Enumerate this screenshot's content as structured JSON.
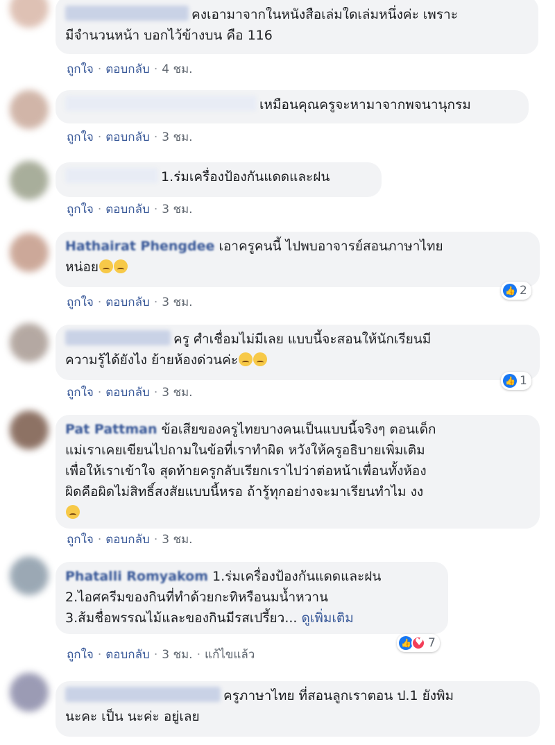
{
  "comments": [
    {
      "name": "",
      "text": "คงเอามาจากในหนังสือเล่มใดเล่มหนึ่งค่ะ เพราะมีจำนวนหน้า บอกไว้ข้างบน คือ 116",
      "line1": "คงเอามาจากในหนังสือเล่มใดเล่มหนึ่งค่ะ เพราะ",
      "line2": "มีจำนวนหน้า บอกไว้ข้างบน คือ 116",
      "like": "ถูกใจ",
      "reply": "ตอบกลับ",
      "time": "4 ชม."
    },
    {
      "name": "",
      "text": "เหมือนคุณครูจะหามาจากพจนานุกรม",
      "like": "ถูกใจ",
      "reply": "ตอบกลับ",
      "time": "3 ชม."
    },
    {
      "name": "",
      "text": "1.ร่มเครื่องป้องกันแดดและฝน",
      "like": "ถูกใจ",
      "reply": "ตอบกลับ",
      "time": "3 ชม."
    },
    {
      "name": "Hathairat Phengdee",
      "line1": "เอาครูคนนี้ ไปพบอาจารย์สอนภาษาไทย",
      "line2": "หน่อย",
      "like": "ถูกใจ",
      "reply": "ตอบกลับ",
      "time": "3 ชม.",
      "reaction_count": "2"
    },
    {
      "name": "",
      "line1": "ครู ศำเชื่อมไม่มีเลย แบบนี้จะสอนให้นักเรียนมี",
      "line2": "ความรู้ได้ยังไง ย้ายห้องด่วนค่ะ",
      "like": "ถูกใจ",
      "reply": "ตอบกลับ",
      "time": "3 ชม.",
      "reaction_count": "1"
    },
    {
      "name": "Pat Pattman",
      "line1": "ข้อเสียของครูไทยบางคนเป็นแบบนี้จริงๆ ตอนเด็ก",
      "line2": "แม่เราเคยเขียนไปถามในข้อที่เราทำผิด หวังให้ครูอธิบายเพิ่มเติม",
      "line3": "เพื่อให้เราเข้าใจ สุดท้ายครูกลับเรียกเราไปว่าต่อหน้าเพื่อนทั้งห้อง",
      "line4": "ผิดคือผิดไม่สิทธิ์สงสัยแบบนี้หรอ ถ้ารู้ทุกอย่างจะมาเรียนทำไม งง",
      "like": "ถูกใจ",
      "reply": "ตอบกลับ",
      "time": "3 ชม."
    },
    {
      "name": "Phatalli Romyakom",
      "line1": "1.ร่มเครื่องป้องกันแดดและฝน",
      "line2": "2.ไอศครีมของกินที่ทำด้วยกะทิหรือนมน้ำหวาน",
      "line3": "3.ส้มชื่อพรรณไม้และของกินมีรสเปรี้ยว...",
      "see_more": "ดูเพิ่มเติม",
      "like": "ถูกใจ",
      "reply": "ตอบกลับ",
      "time": "3 ชม.",
      "edited": "แก้ไขแล้ว",
      "reaction_count": "7"
    },
    {
      "name": "",
      "line1": "ครูภาษาไทย ที่สอนลูกเราตอน ป.1 ยังพิม",
      "line2": "นะคะ เป็น นะค่ะ อยู่เลย"
    }
  ],
  "colors": {
    "bubble": "#f2f3f5",
    "link": "#385898",
    "meta": "#606770",
    "like_blue": "#1877f2",
    "love_red": "#f33e58"
  }
}
